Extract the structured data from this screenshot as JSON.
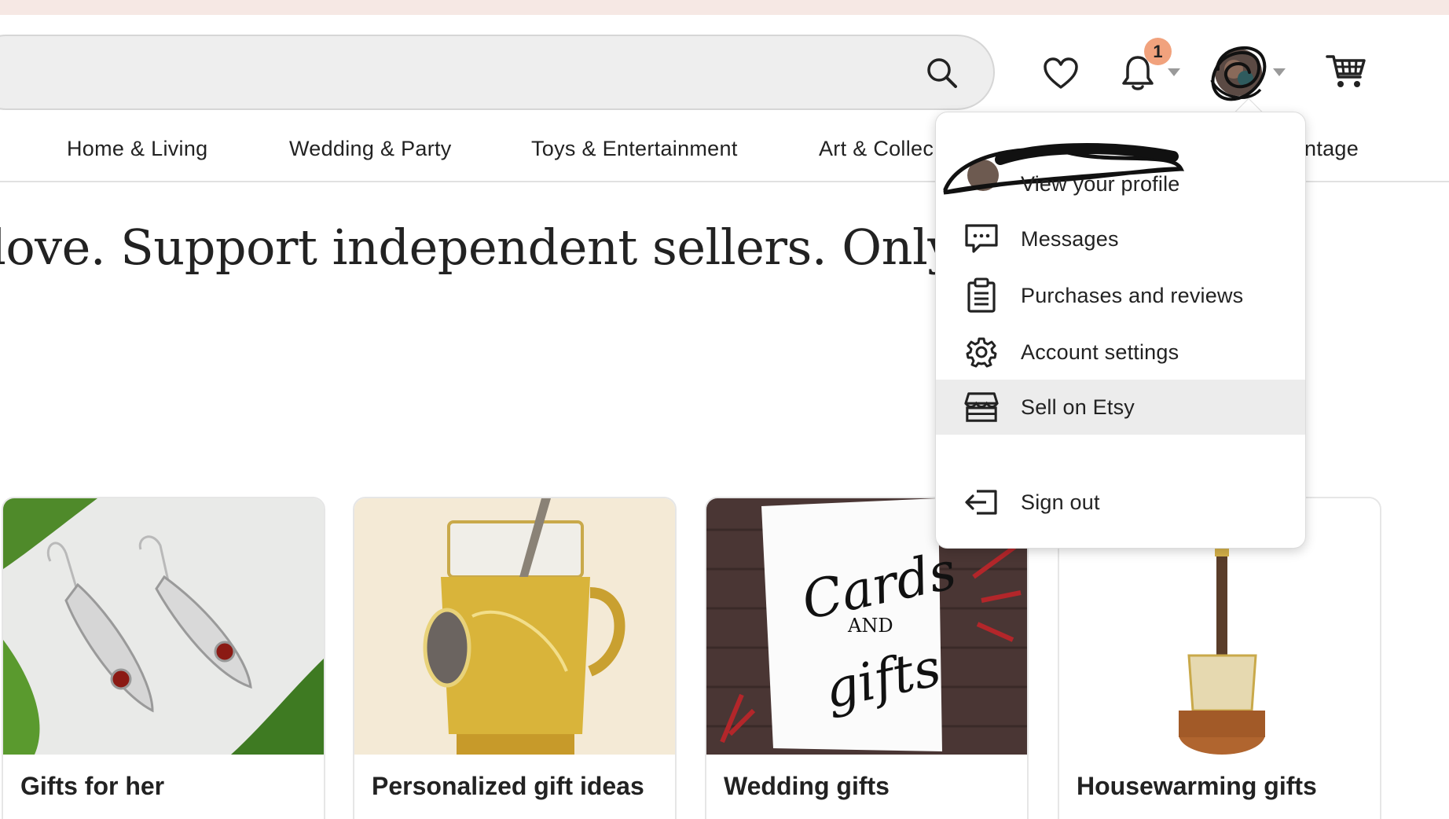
{
  "header": {
    "search_placeholder": "",
    "notification_count": "1"
  },
  "categories": [
    {
      "label": "Home & Living"
    },
    {
      "label": "Wedding & Party"
    },
    {
      "label": "Toys & Entertainment"
    },
    {
      "label": "Art & Collec"
    },
    {
      "label": "ntage"
    }
  ],
  "hero": {
    "text": "love. Support independent sellers. Only on"
  },
  "cards": [
    {
      "title": "Gifts for her"
    },
    {
      "title": "Personalized gift ideas"
    },
    {
      "title": "Wedding gifts"
    },
    {
      "title": "Housewarming gifts"
    }
  ],
  "card_art": {
    "wedding_card_text_1": "Cards",
    "wedding_card_text_2": "AND",
    "wedding_card_text_3": "gifts"
  },
  "account_menu": {
    "view_profile": "View your profile",
    "items": [
      {
        "label": "Messages",
        "icon": "messages-icon"
      },
      {
        "label": "Purchases and reviews",
        "icon": "clipboard-icon"
      },
      {
        "label": "Account settings",
        "icon": "gear-icon"
      },
      {
        "label": "Sell on Etsy",
        "icon": "shop-icon"
      },
      {
        "label": "Sign out",
        "icon": "sign-out-icon"
      }
    ]
  },
  "colors": {
    "top_strip": "#f6e8e4",
    "badge": "#f1a27d",
    "menu_highlight": "#ececec",
    "search_bg": "#eeeeee"
  }
}
